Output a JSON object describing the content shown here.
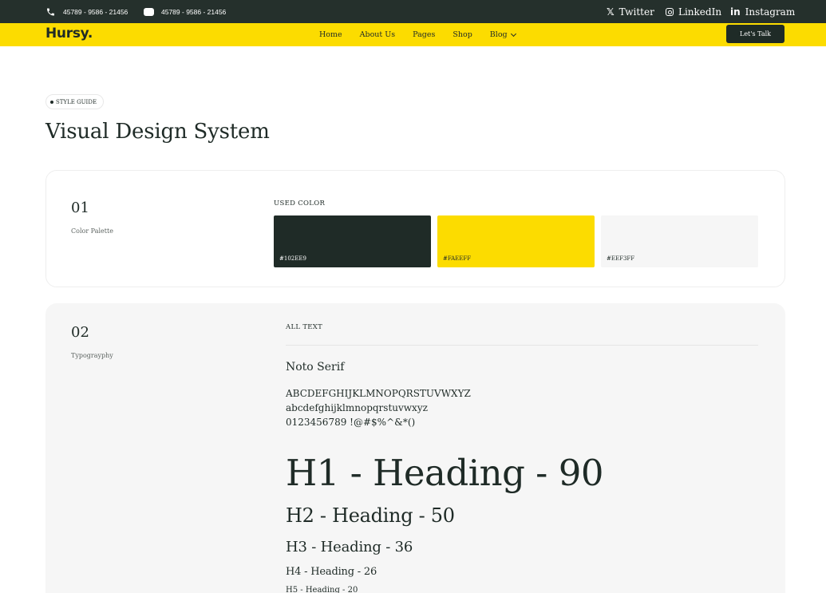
{
  "topbar": {
    "phone": "45789 - 9586 - 21456",
    "message": "45789 - 9586 - 21456",
    "social": [
      {
        "label": "Twitter",
        "icon": "x-icon"
      },
      {
        "label": "LinkedIn",
        "icon": "instagram-icon"
      },
      {
        "label": "Instagram",
        "icon": "linkedin-icon"
      }
    ]
  },
  "nav": {
    "logo": "Hursy.",
    "links": [
      "Home",
      "About Us",
      "Pages",
      "Shop",
      "Blog"
    ],
    "cta": "Let's Talk"
  },
  "hero": {
    "badge": "STYLE GUIDE",
    "title": "Visual Design System"
  },
  "colors": {
    "number": "01",
    "name": "Color Palette",
    "heading": "USED  COLOR",
    "swatches": [
      {
        "code": "#102EE9",
        "fill": "#1f2b27",
        "text": "#ffffff"
      },
      {
        "code": "#FAEEFF",
        "fill": "#fcdc00",
        "text": "#1f2b27"
      },
      {
        "code": "#EEF3FF",
        "fill": "#f6f6f6",
        "text": "#1f2b27"
      }
    ]
  },
  "typography": {
    "number": "02",
    "name": "Typograyphy",
    "heading": "ALL TEXT",
    "font_name": "Noto Serif",
    "uppercase": "ABCDEFGHIJKLMNOPQRSTUVWXYZ",
    "lowercase": "abcdefghijklmnopqrstuvwxyz",
    "numbers": "0123456789 !@#$%^&*()",
    "h1": "H1 - Heading - 90",
    "h2": "H2 - Heading - 50",
    "h3": "H3 - Heading - 36",
    "h4": "H4 - Heading - 26",
    "h5": "H5 - Heading - 20"
  },
  "theme": {
    "accent": "#fcdc00",
    "dark": "#1f2b27",
    "topbar": "#25302c"
  }
}
